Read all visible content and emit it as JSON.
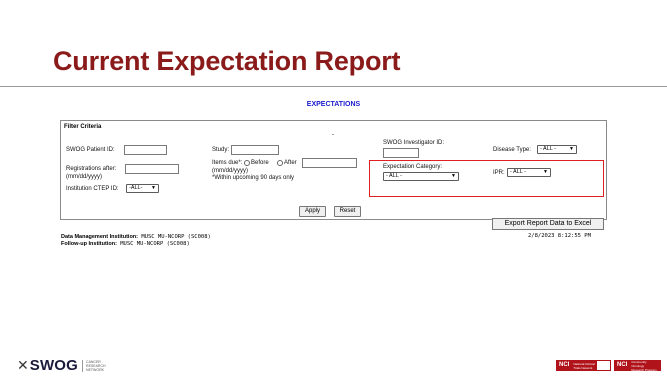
{
  "slide": {
    "title": "Current Expectation Report"
  },
  "report": {
    "heading": "EXPECTATIONS",
    "filter_title": "Filter Criteria",
    "dash": "-",
    "fields": {
      "patient_id_label": "SWOG Patient ID:",
      "study_label": "Study:",
      "investigator_label": "SWOG Investigator ID:",
      "disease_type_label": "Disease Type:",
      "disease_type_value": "- ALL -",
      "registrations_label": "Registrations after:",
      "registrations_hint": "(mm/dd/yyyy)",
      "items_due_label": "Items due*:",
      "before_label": "Before",
      "after_label": "After",
      "items_due_hint": "(mm/dd/yyyy)",
      "items_due_note": "*Within upcoming 90 days only",
      "expectation_category_label": "Expectation Category:",
      "expectation_category_value": "- ALL -",
      "ipr_label": "IPR:",
      "ipr_value": "- ALL -",
      "ctep_label": "Institution CTEP ID:",
      "ctep_value": "-ALL-"
    },
    "buttons": {
      "apply": "Apply",
      "reset": "Reset",
      "export": "Export Report Data to Excel"
    },
    "institutions": {
      "dm_label": "Data Management Institution:",
      "dm_value": "MUSC MU-NCORP (SC008)",
      "fu_label": "Follow-up Institution:",
      "fu_value": "MUSC MU-NCORP (SC008)"
    },
    "timestamp": "2/8/2023 8:12:55 PM"
  },
  "footer": {
    "logo_text": "SWOG",
    "logo_tag_1": "CANCER",
    "logo_tag_2": "RESEARCH",
    "logo_tag_3": "NETWORK",
    "badge1_nci": "NCI",
    "badge1_text_1": "National Clinical",
    "badge1_text_2": "Trials Network",
    "badge2_nci": "NCI",
    "badge2_text_1": "Community Oncology",
    "badge2_text_2": "Research Program"
  },
  "colors": {
    "title": "#8b1a1a",
    "heading_link": "#1a1acc",
    "highlight_border": "#e02020",
    "nci_red": "#b0131a"
  }
}
